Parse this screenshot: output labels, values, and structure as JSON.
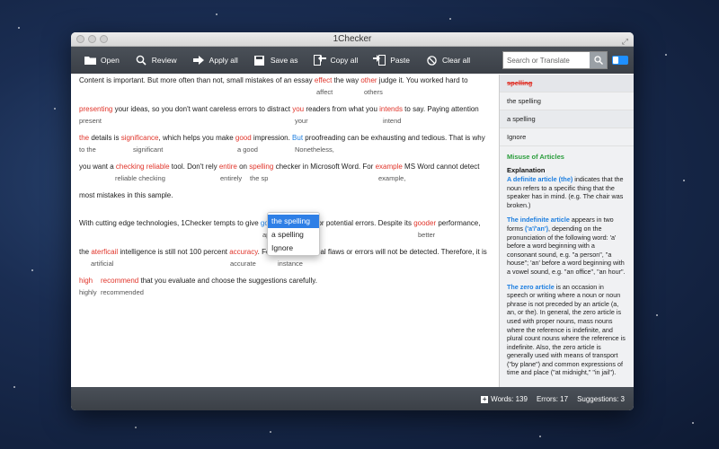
{
  "window": {
    "title": "1Checker"
  },
  "toolbar": {
    "open": "Open",
    "review": "Review",
    "apply_all": "Apply all",
    "save_as": "Save as",
    "copy_all": "Copy all",
    "paste": "Paste",
    "clear_all": "Clear all"
  },
  "search": {
    "placeholder": "Search or Translate"
  },
  "text": {
    "l1a": "Content is important. But more often than not, small mistakes of an essay ",
    "l1e1": "effect",
    "l1b": " the way ",
    "l1e2": "other",
    "l1c": " judge it. You worked hard to",
    "s1a": "affect",
    "s1b": "others",
    "l2e1": "presenting",
    "l2a": " your ideas, so you don't want careless errors to distract ",
    "l2e2": "you",
    "l2b": " readers from what you ",
    "l2e3": "intends",
    "l2c": " to say. Paying attention",
    "s2a": "present",
    "s2b": "your",
    "s2c": "intend",
    "l3e1": "the",
    "l3a": " details is ",
    "l3e2": "significance",
    "l3b": ", which helps you make ",
    "l3e3": "good",
    "l3c": " impression. ",
    "l3e4": "But",
    "l3d": " proofreading can be exhausting and tedious. That is why",
    "s3a": "to the",
    "s3b": "significant",
    "s3c": "a good",
    "s3d": "Nonetheless,",
    "l4a": "you want a ",
    "l4e1": "checking reliable",
    "l4b": " tool. Don't rely ",
    "l4e2": "entire",
    "l4c": " on ",
    "l4e3": "spelling",
    "l4d": " checker in Microsoft Word. For ",
    "l4e4": "example",
    "l4f": " MS Word cannot detect",
    "s4a": "reliable checking",
    "s4b": "entirely",
    "s4c": "the sp",
    "s4d": "example,",
    "l5": "most mistakes in this sample.",
    "l6a": "With cutting edge technologies, 1Checker tempts to give ",
    "l6e1": "good",
    "l6b": " corrections for potential errors. Despite its ",
    "l6e2": "gooder",
    "l6c": " performance,",
    "s6a": "appropriate",
    "s6b": "better",
    "l7a": "the ",
    "l7e1": "aterficail",
    "l7b": " intelligence is still not 100 percent ",
    "l7e2": "accuracy",
    "l7c": ". For ",
    "l7e3": "example",
    "l7d": ", logical flaws or errors will not be detected. Therefore, it is",
    "s7a": "artificial",
    "s7b": "accurate",
    "s7c": "instance",
    "l8e1": "high",
    "l8e2": "recommend",
    "l8a": " that you evaluate and choose the suggestions carefully.",
    "s8a": "highly",
    "s8b": "recommended"
  },
  "popup": {
    "items": [
      "the spelling",
      "a spelling",
      "Ignore"
    ]
  },
  "sidebar": {
    "items": [
      "spelling",
      "the spelling",
      "a spelling",
      "Ignore"
    ],
    "section": "Misuse of Articles",
    "explanation_title": "Explanation",
    "p1_term": "A definite article (the)",
    "p1_text": " indicates that the noun refers to a specific thing that the speaker has in mind. (e.g. The chair was broken.)",
    "p2_term": "The indefinite article",
    "p2_text_a": " appears in two forms ",
    "p2_term2": "('a'/'an')",
    "p2_text_b": ", depending on the pronunciation of the following word: 'a' before a word beginning with a consonant sound, e.g. \"a person\", \"a house\"; 'an' before a word beginning with a vowel sound, e.g. \"an office\", \"an hour\".",
    "p3_term": "The zero article",
    "p3_text": " is an occasion in speech or writing where a noun or noun phrase is not preceded by an article (a, an, or the). In general, the zero article is used with proper nouns, mass nouns where the reference is indefinite, and plural count nouns where the reference is indefinite. Also, the zero article is generally used with means of transport (\"by plane\") and common expressions of time and place (\"at midnight,\" \"in jail\")."
  },
  "status": {
    "words": "Words:  139",
    "errors": "Errors:  17",
    "suggestions": "Suggestions:  3"
  }
}
